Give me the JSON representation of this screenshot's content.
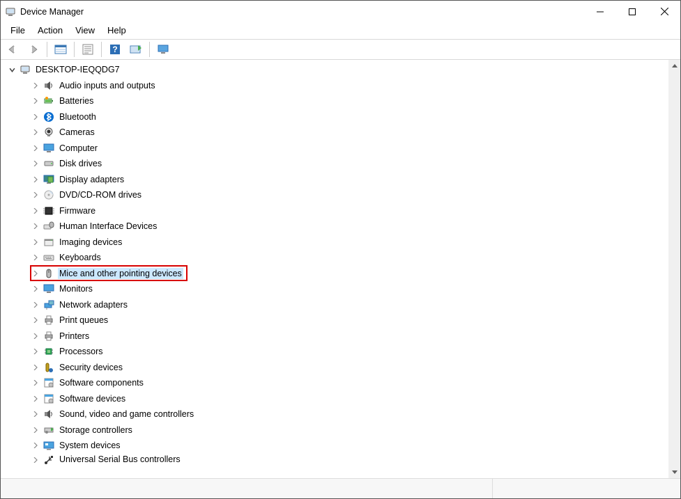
{
  "window": {
    "title": "Device Manager"
  },
  "menubar": [
    "File",
    "Action",
    "View",
    "Help"
  ],
  "tree": {
    "root": {
      "label": "DESKTOP-IEQQDG7",
      "expanded": true
    },
    "items": [
      {
        "label": "Audio inputs and outputs",
        "icon": "audio"
      },
      {
        "label": "Batteries",
        "icon": "battery"
      },
      {
        "label": "Bluetooth",
        "icon": "bluetooth"
      },
      {
        "label": "Cameras",
        "icon": "camera"
      },
      {
        "label": "Computer",
        "icon": "monitor"
      },
      {
        "label": "Disk drives",
        "icon": "disk"
      },
      {
        "label": "Display adapters",
        "icon": "display"
      },
      {
        "label": "DVD/CD-ROM drives",
        "icon": "dvd"
      },
      {
        "label": "Firmware",
        "icon": "firmware"
      },
      {
        "label": "Human Interface Devices",
        "icon": "hid"
      },
      {
        "label": "Imaging devices",
        "icon": "imaging"
      },
      {
        "label": "Keyboards",
        "icon": "keyboard"
      },
      {
        "label": "Mice and other pointing devices",
        "icon": "mouse",
        "highlighted": true
      },
      {
        "label": "Monitors",
        "icon": "monitor"
      },
      {
        "label": "Network adapters",
        "icon": "network"
      },
      {
        "label": "Print queues",
        "icon": "printer"
      },
      {
        "label": "Printers",
        "icon": "printer"
      },
      {
        "label": "Processors",
        "icon": "cpu"
      },
      {
        "label": "Security devices",
        "icon": "security"
      },
      {
        "label": "Software components",
        "icon": "software"
      },
      {
        "label": "Software devices",
        "icon": "software"
      },
      {
        "label": "Sound, video and game controllers",
        "icon": "audio"
      },
      {
        "label": "Storage controllers",
        "icon": "storage"
      },
      {
        "label": "System devices",
        "icon": "system"
      },
      {
        "label": "Universal Serial Bus controllers",
        "icon": "usb",
        "cut": true
      }
    ]
  }
}
